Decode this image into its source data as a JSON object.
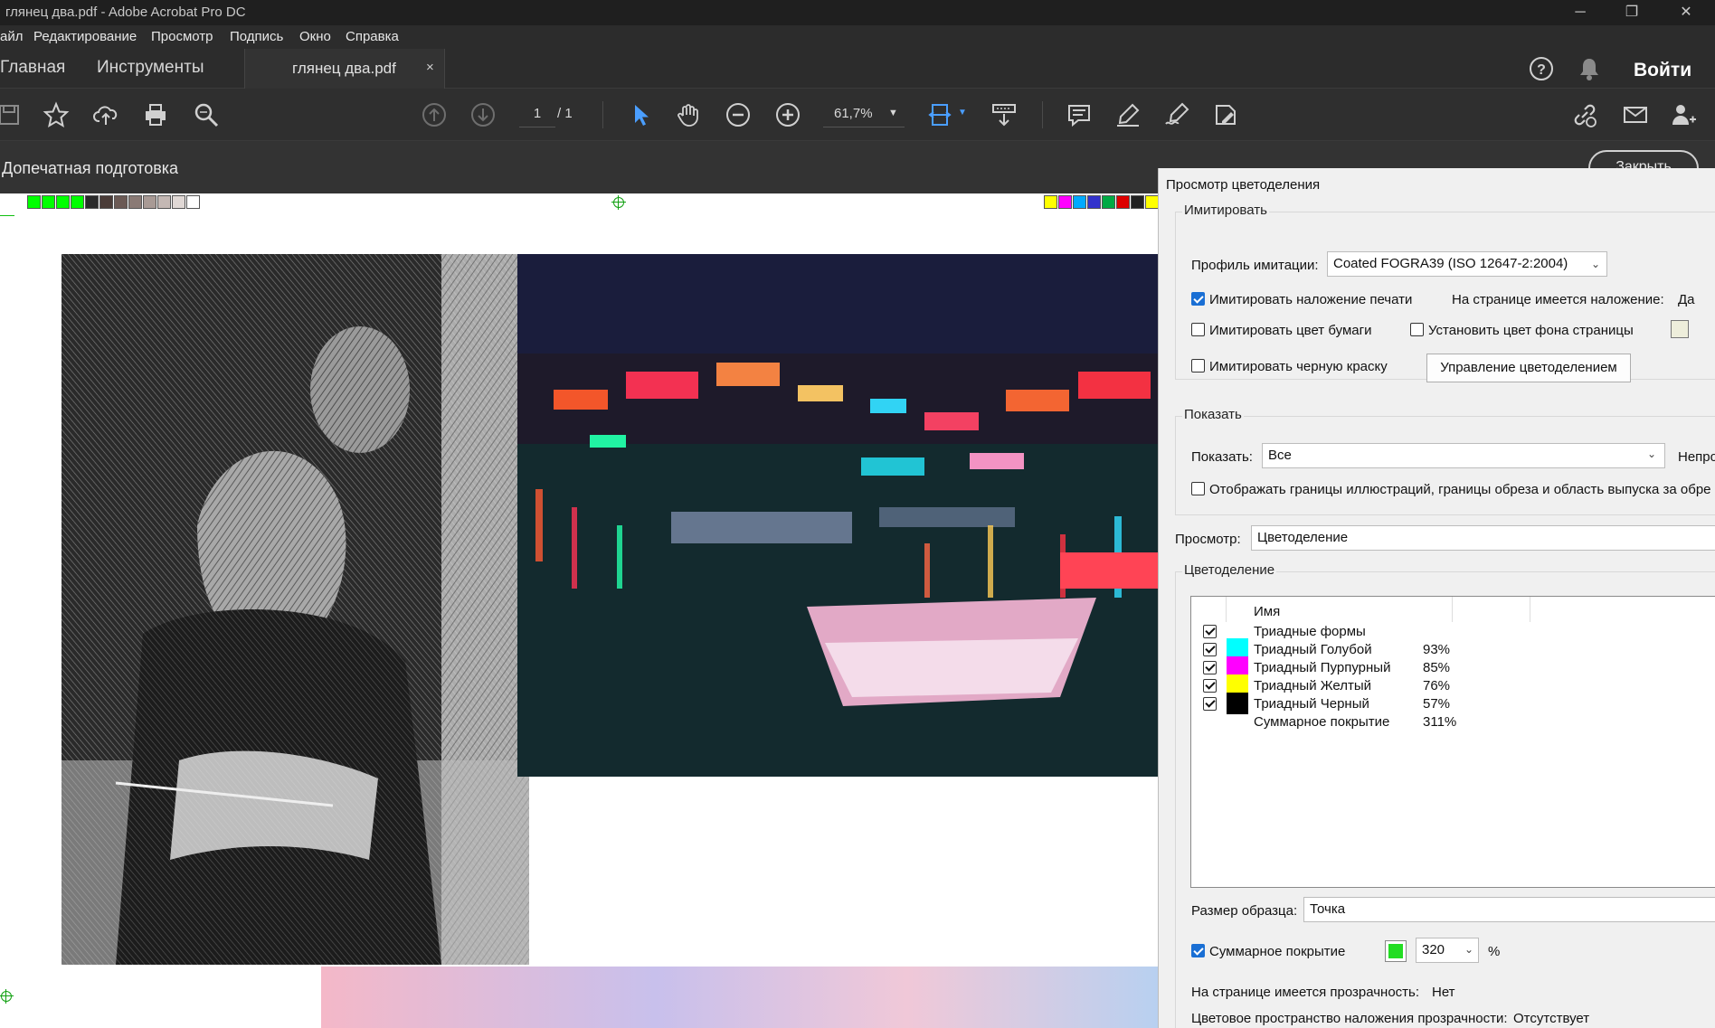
{
  "window": {
    "title": "глянец два.pdf - Adobe Acrobat Pro DC"
  },
  "menu": [
    "айл",
    "Редактирование",
    "Просмотр",
    "Подпись",
    "Окно",
    "Справка"
  ],
  "tabs": {
    "home": "Главная",
    "tools": "Инструменты",
    "document": "глянец два.pdf",
    "close_glyph": "×",
    "login": "Войти"
  },
  "toolbar": {
    "page_current": "1",
    "page_total": "/ 1",
    "zoom": "61,7%"
  },
  "subbar": {
    "title": "Допечатная подготовка",
    "close_label": "Закрыть"
  },
  "colors": {
    "accent": "#1a6fd4",
    "tool_blue": "#4a9eff",
    "coverage_color": "#22dd22"
  },
  "dialog": {
    "title": "Просмотр цветоделения",
    "simulate": {
      "group_label": "Имитировать",
      "profile_label": "Профиль имитации:",
      "profile_value": "Coated FOGRA39 (ISO 12647-2:2004)",
      "overprint_label": "Имитировать наложение печати",
      "overprint_checked": true,
      "overprint_status_label": "На странице имеется наложение:",
      "overprint_status_value": "Да",
      "paper_color_label": "Имитировать цвет бумаги",
      "paper_color_checked": false,
      "page_bg_label": "Установить цвет фона страницы",
      "page_bg_checked": false,
      "black_ink_label": "Имитировать черную краску",
      "black_ink_checked": false,
      "ink_manager_button": "Управление цветоделением"
    },
    "show": {
      "group_label": "Показать",
      "show_label": "Показать:",
      "show_value": "Все",
      "truncated_label": "Непроз",
      "boxes_label": "Отображать границы иллюстраций, границы обреза и область выпуска за обре",
      "boxes_checked": false
    },
    "preview": {
      "label": "Просмотр:",
      "value": "Цветоделение"
    },
    "separations": {
      "group_label": "Цветоделение",
      "header_name": "Имя",
      "rows": [
        {
          "name": "Триадные формы",
          "pct": "",
          "color": "",
          "checked": true
        },
        {
          "name": "Триадный Голубой",
          "pct": "93%",
          "color": "#00ffff",
          "checked": true
        },
        {
          "name": "Триадный Пурпурный",
          "pct": "85%",
          "color": "#ff00ff",
          "checked": true
        },
        {
          "name": "Триадный Желтый",
          "pct": "76%",
          "color": "#ffff00",
          "checked": true
        },
        {
          "name": "Триадный Черный",
          "pct": "57%",
          "color": "#000000",
          "checked": true
        },
        {
          "name": "Суммарное покрытие",
          "pct": "311%",
          "color": "",
          "checked": false
        }
      ]
    },
    "sample": {
      "label": "Размер образца:",
      "value": "Точка"
    },
    "total_coverage": {
      "label": "Суммарное покрытие",
      "checked": true,
      "value": "320",
      "unit": "%"
    },
    "transparency_label": "На странице имеется прозрачность:",
    "transparency_value": "Нет",
    "blend_space_label": "Цветовое пространство наложения прозрачности:",
    "blend_space_value": "Отсутствует"
  },
  "document_art": {
    "top_left_bar": [
      "#00ff00",
      "#00ff00",
      "#00ff00",
      "#00ff00",
      "#2a2a2a",
      "#4a3c38",
      "#6b5a55",
      "#8a7a75",
      "#a89a95",
      "#c4b8b4",
      "#e0d8d5",
      "#ffffff"
    ],
    "top_right_bar": [
      "#ffff00",
      "#ff00ff",
      "#00aaff",
      "#3333cc",
      "#00aa44",
      "#dd0000",
      "#222222",
      "#ffff00"
    ]
  }
}
